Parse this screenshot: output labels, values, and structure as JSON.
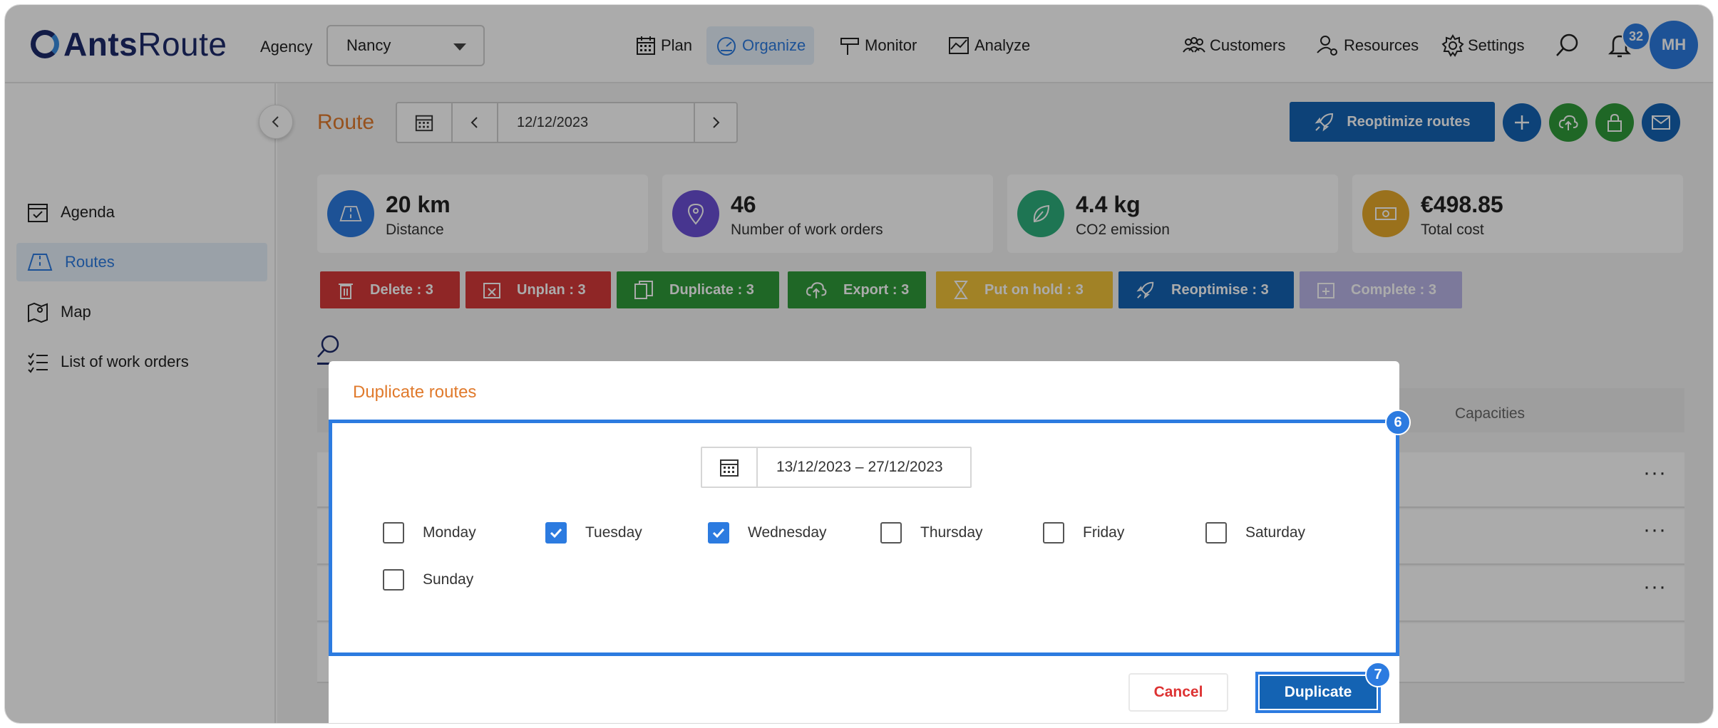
{
  "topbar": {
    "logo_bold": "Ants",
    "logo_light": "Route",
    "agency_label": "Agency",
    "agency_value": "Nancy",
    "nav": [
      {
        "label": "Plan",
        "icon": "calendar-icon"
      },
      {
        "label": "Organize",
        "icon": "gauge-icon",
        "active": true
      },
      {
        "label": "Monitor",
        "icon": "signpost-icon"
      },
      {
        "label": "Analyze",
        "icon": "chart-icon"
      }
    ],
    "right_nav": [
      {
        "label": "Customers",
        "icon": "people-icon"
      },
      {
        "label": "Resources",
        "icon": "user-gear-icon"
      },
      {
        "label": "Settings",
        "icon": "gear-icon"
      }
    ],
    "notifications_count": "32",
    "avatar_initials": "MH"
  },
  "sidebar": {
    "items": [
      {
        "label": "Agenda",
        "icon": "calendar-check-icon"
      },
      {
        "label": "Routes",
        "icon": "road-icon",
        "active": true
      },
      {
        "label": "Map",
        "icon": "map-icon"
      },
      {
        "label": "List of work orders",
        "icon": "list-icon"
      }
    ]
  },
  "header": {
    "title": "Route",
    "date": "12/12/2023",
    "reoptimize_label": "Reoptimize routes"
  },
  "stats": [
    {
      "value": "20 km",
      "label": "Distance",
      "color": "#2c7be0"
    },
    {
      "value": "46",
      "label": "Number of work orders",
      "color": "#6a4fd6"
    },
    {
      "value": "4.4 kg",
      "label": "CO2 emission",
      "color": "#2eaf7d"
    },
    {
      "value": "€498.85",
      "label": "Total cost",
      "color": "#e6a92a"
    }
  ],
  "bulk_actions": [
    {
      "label": "Delete : 3",
      "color": "#d63a3a"
    },
    {
      "label": "Unplan : 3",
      "color": "#d63a3a"
    },
    {
      "label": "Duplicate : 3",
      "color": "#2f9a3a"
    },
    {
      "label": "Export : 3",
      "color": "#2f9a3a"
    },
    {
      "label": "Put on hold : 3",
      "color": "#f0c23a"
    },
    {
      "label": "Reoptimise : 3",
      "color": "#1463b3"
    },
    {
      "label": "Complete : 3",
      "color": "#b9b5e8"
    }
  ],
  "table": {
    "capacities_header": "Capacities"
  },
  "modal": {
    "title": "Duplicate routes",
    "date_range": "13/12/2023 – 27/12/2023",
    "days": [
      {
        "label": "Monday",
        "checked": false
      },
      {
        "label": "Tuesday",
        "checked": true
      },
      {
        "label": "Wednesday",
        "checked": true
      },
      {
        "label": "Thursday",
        "checked": false
      },
      {
        "label": "Friday",
        "checked": false
      },
      {
        "label": "Saturday",
        "checked": false
      },
      {
        "label": "Sunday",
        "checked": false
      }
    ],
    "cancel_label": "Cancel",
    "duplicate_label": "Duplicate",
    "step_badges": [
      "6",
      "7"
    ]
  }
}
